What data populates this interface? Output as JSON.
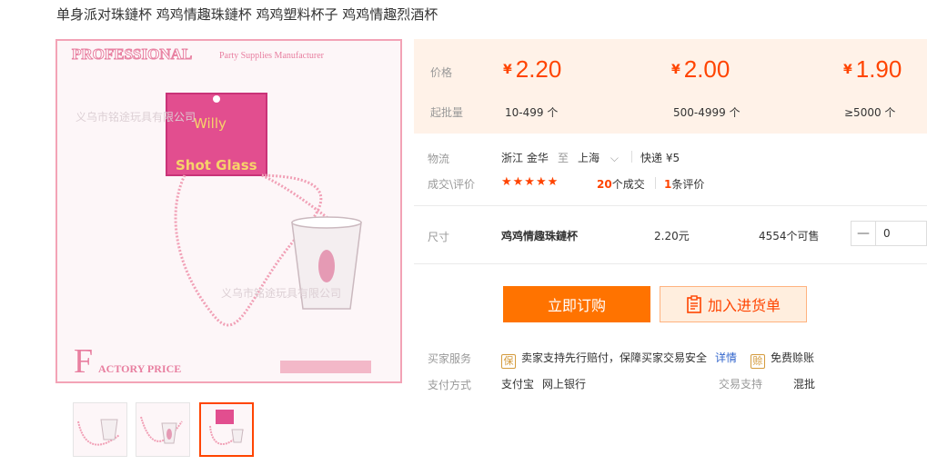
{
  "title": "单身派对珠鏈杯 鸡鸡情趣珠鏈杯 鸡鸡塑料杯子 鸡鸡情趣烈酒杯",
  "product_image": {
    "brand": "PROFESSIONAL",
    "brand_sub": "Party Supplies Manufacturer",
    "card_line1": "Willy",
    "card_line2": "Shot Glass",
    "watermark": "义乌市铭途玩具有限公司",
    "footer_left": "ACTORY PRICE",
    "footer_letter": "F"
  },
  "price_section": {
    "price_label": "价格",
    "moq_label": "起批量",
    "currency": "¥",
    "tiers": [
      {
        "price": "2.20",
        "moq": "10-499 个"
      },
      {
        "price": "2.00",
        "moq": "500-4999 个"
      },
      {
        "price": "1.90",
        "moq": "≥5000 个"
      }
    ]
  },
  "logistics": {
    "label": "物流",
    "from": "浙江 金华",
    "to_word": "至",
    "to": "上海",
    "express": "快递 ¥5"
  },
  "reviews": {
    "label": "成交\\评价",
    "stars": "★★★★★",
    "deals_count": "20",
    "deals_text": "个成交",
    "review_count": "1",
    "review_text": "条评价"
  },
  "sku": {
    "label": "尺寸",
    "name": "鸡鸡情趣珠鏈杯",
    "price": "2.20元",
    "stock": "4554个可售",
    "quantity": "0",
    "minus": "—"
  },
  "buttons": {
    "buy": "立即订购",
    "cart": "加入进货单"
  },
  "services": {
    "label": "买家服务",
    "item1": "卖家支持先行赔付，保障买家交易安全",
    "item1_link": "详情",
    "item2": "免费赊账",
    "icon1": "保",
    "icon2": "赊"
  },
  "payment": {
    "label": "支付方式",
    "methods": [
      "支付宝",
      "网上银行"
    ],
    "trade_label": "交易支持",
    "trade_value": "混批"
  },
  "colors": {
    "accent": "#ff4400",
    "buy_button": "#ff7300",
    "price_bg": "#fff2e8",
    "image_border": "#f3a3b6"
  }
}
